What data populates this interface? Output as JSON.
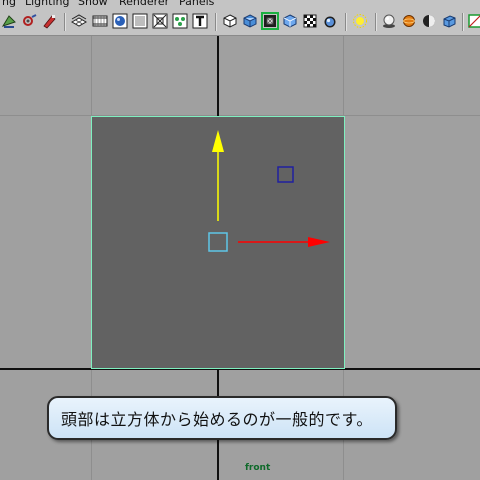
{
  "menus": [
    "ng",
    "Lighting",
    "Show",
    "Renderer",
    "Panels"
  ],
  "toolbar": {
    "icons": [
      "select-camera-icon",
      "camera-attributes-icon",
      "bookmark-icon",
      "grid-toggle-icon",
      "film-gate-icon",
      "resolution-gate-icon",
      "gate-mask-icon",
      "field-chart-icon",
      "safe-action-icon",
      "safe-title-icon",
      "wireframe-icon",
      "smooth-shade-icon",
      "wireframe-on-shaded-icon",
      "flat-shade-icon",
      "textured-icon",
      "use-all-lights-icon",
      "shadows-icon",
      "isolate-select-icon",
      "xray-icon",
      "xray-joints-icon",
      "xray-components-icon",
      "backface-culling-icon"
    ]
  },
  "viewport": {
    "camera_label": "front",
    "axis_color": "#101010",
    "grid_color": "#8e8e8e",
    "background": "#a0a0a0",
    "object_face_color": "#626262",
    "object_highlight_color": "#7ff0c0"
  },
  "manipulator": {
    "y_axis_color": "#ffff00",
    "x_axis_color": "#ff0000",
    "center_handle_color": "#5ec6e8",
    "z_handle_color": "#2020a0"
  },
  "subtitle": {
    "text": "頭部は立方体から始めるのが一般的です。"
  }
}
